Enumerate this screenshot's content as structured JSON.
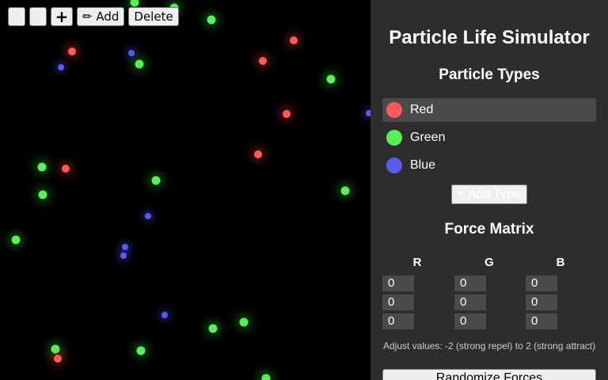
{
  "toolbar": {
    "buttons": [
      {
        "name": "pause-button",
        "icon": "pause-icon",
        "label": ""
      },
      {
        "name": "reset-button",
        "icon": "reset-icon",
        "label": ""
      },
      {
        "name": "add-particles-button",
        "icon": "plus-icon",
        "label": "+"
      },
      {
        "name": "add-mode-button",
        "icon": "pencil-icon",
        "label": "✏ Add"
      },
      {
        "name": "delete-mode-button",
        "icon": "trash-icon",
        "label": " Delete"
      }
    ]
  },
  "panel": {
    "title": "Particle Life Simulator",
    "types_heading": "Particle Types",
    "types": [
      {
        "label": "Red",
        "color": "#ff5a5a",
        "selected": true
      },
      {
        "label": "Green",
        "color": "#5aef5a",
        "selected": false
      },
      {
        "label": "Blue",
        "color": "#5a5aef",
        "selected": false
      }
    ],
    "add_type_label": "+ Add Type",
    "matrix_heading": "Force Matrix",
    "matrix_columns": [
      "R",
      "G",
      "B"
    ],
    "matrix_values": [
      [
        "0",
        "0",
        "0"
      ],
      [
        "0",
        "0",
        "0"
      ],
      [
        "0",
        "0",
        "0"
      ]
    ],
    "hint": "Adjust values: -2 (strong repel) to 2 (strong attract)",
    "randomize_label": " Randomize Forces"
  }
}
